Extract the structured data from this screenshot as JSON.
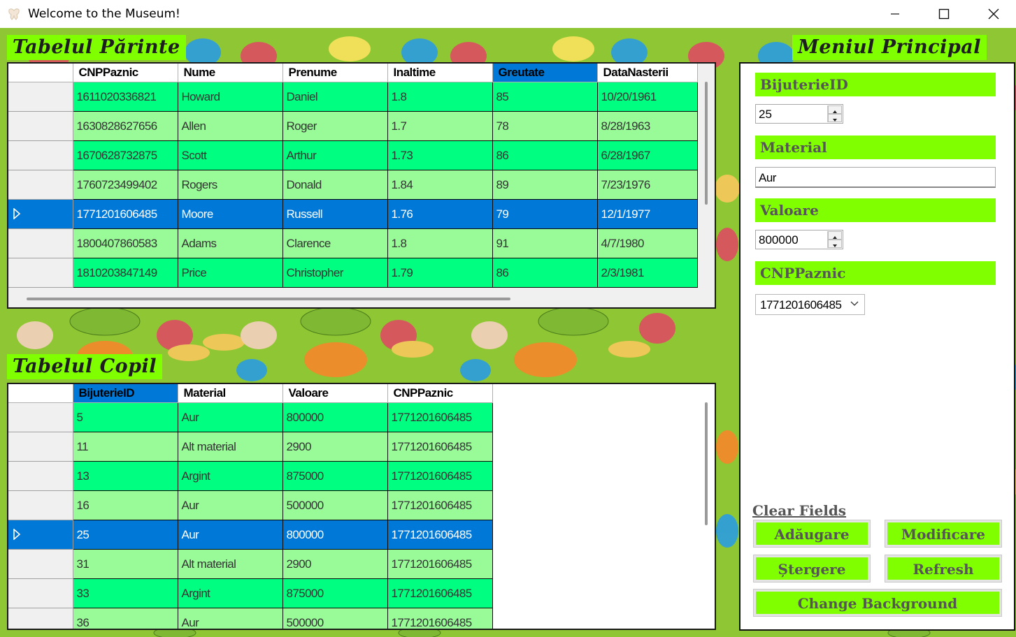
{
  "window": {
    "title": "Welcome to the Museum!"
  },
  "sections": {
    "parent_title": "Tabelul Părinte",
    "child_title": "Tabelul Copil",
    "menu_title": "Meniul Principal"
  },
  "parent_table": {
    "columns": [
      "CNPPaznic",
      "Nume",
      "Prenume",
      "Inaltime",
      "Greutate",
      "DataNasterii"
    ],
    "selected_column": "Greutate",
    "selected_row": 4,
    "rows": [
      [
        "1611020336821",
        "Howard",
        "Daniel",
        "1.8",
        "85",
        "10/20/1961"
      ],
      [
        "1630828627656",
        "Allen",
        "Roger",
        "1.7",
        "78",
        "8/28/1963"
      ],
      [
        "1670628732875",
        "Scott",
        "Arthur",
        "1.73",
        "86",
        "6/28/1967"
      ],
      [
        "1760723499402",
        "Rogers",
        "Donald",
        "1.84",
        "89",
        "7/23/1976"
      ],
      [
        "1771201606485",
        "Moore",
        "Russell",
        "1.76",
        "79",
        "12/1/1977"
      ],
      [
        "1800407860583",
        "Adams",
        "Clarence",
        "1.8",
        "91",
        "4/7/1980"
      ],
      [
        "1810203847149",
        "Price",
        "Christopher",
        "1.79",
        "86",
        "2/3/1981"
      ]
    ]
  },
  "child_table": {
    "columns": [
      "BijuterieID",
      "Material",
      "Valoare",
      "CNPPaznic"
    ],
    "selected_column": "BijuterieID",
    "selected_row": 4,
    "rows": [
      [
        "5",
        "Aur",
        "800000",
        "1771201606485"
      ],
      [
        "11",
        "Alt material",
        "2900",
        "1771201606485"
      ],
      [
        "13",
        "Argint",
        "875000",
        "1771201606485"
      ],
      [
        "16",
        "Aur",
        "500000",
        "1771201606485"
      ],
      [
        "25",
        "Aur",
        "800000",
        "1771201606485"
      ],
      [
        "31",
        "Alt material",
        "2900",
        "1771201606485"
      ],
      [
        "33",
        "Argint",
        "875000",
        "1771201606485"
      ],
      [
        "36",
        "Aur",
        "500000",
        "1771201606485"
      ]
    ]
  },
  "form": {
    "bijuterie_label": "BijuterieID",
    "bijuterie_value": "25",
    "material_label": "Material",
    "material_value": "Aur",
    "valoare_label": "Valoare",
    "valoare_value": "800000",
    "cnp_label": "CNPPaznic",
    "cnp_value": "1771201606485"
  },
  "actions": {
    "clear": "Clear Fields",
    "add": "Adăugare",
    "modify": "Modificare",
    "delete": "Ștergere",
    "refresh": "Refresh",
    "change_bg": "Change Background"
  },
  "colors": {
    "row_bright": "#00ff80",
    "row_light": "#98fb98",
    "selection": "#0078d7",
    "accent": "#80ff00",
    "background": "#8ec536"
  }
}
